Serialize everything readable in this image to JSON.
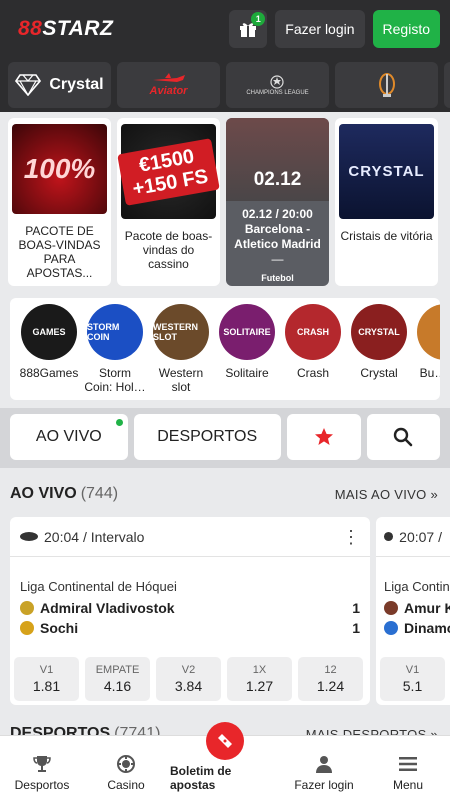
{
  "header": {
    "logo_prefix": "88",
    "logo_text": "STARZ",
    "gift_badge": "1",
    "login_label": "Fazer login",
    "register_label": "Registo"
  },
  "top_categories": [
    {
      "label": "Crystal",
      "icon": "diamond-icon"
    },
    {
      "label": "Aviator",
      "icon": "plane-icon"
    },
    {
      "label": "CHAMPIONS LEAGUE",
      "icon": "ucl-icon"
    },
    {
      "label": "",
      "icon": "trophy-icon"
    }
  ],
  "promos": [
    {
      "img_text": "100%",
      "label": "PACOTE DE BOAS-VINDAS PARA APOSTAS..."
    },
    {
      "img_text": "€1500 +150 FS",
      "label": "Pacote de boas-vindas do cassino"
    },
    {
      "date": "02.12",
      "time": "02.12 / 20:00",
      "teams": "Barcelona - Atletico Madrid",
      "dash": "—",
      "sport": "Futebol"
    },
    {
      "img_text": "CRYSTAL",
      "label": "Cristais de vitória"
    }
  ],
  "games": [
    {
      "icon_text": "GAMES",
      "label": "888Games",
      "color": "#1a1a1a"
    },
    {
      "icon_text": "STORM COIN",
      "label": "Storm Coin: Hol…",
      "color": "#1b4fc4"
    },
    {
      "icon_text": "WESTERN SLOT",
      "label": "Western slot",
      "color": "#6b4a2a"
    },
    {
      "icon_text": "SOLITAIRE",
      "label": "Solitaire",
      "color": "#7a1e6e"
    },
    {
      "icon_text": "CRASH",
      "label": "Crash",
      "color": "#b4282d"
    },
    {
      "icon_text": "CRYSTAL",
      "label": "Crystal",
      "color": "#8a1f1f"
    },
    {
      "icon_text": "",
      "label": "Bu… H…",
      "color": "#c77a2a"
    }
  ],
  "tabs": {
    "live": "AO VIVO",
    "sports": "DESPORTOS"
  },
  "live_section": {
    "title": "AO VIVO",
    "count": "(744)",
    "more": "MAIS AO VIVO"
  },
  "sports_section": {
    "title": "DESPORTOS",
    "count": "(7741)",
    "more": "MAIS DESPORTOS"
  },
  "events": [
    {
      "time": "20:04",
      "status": "/ Intervalo",
      "league": "Liga Continental de Hóquei",
      "team1": "Admiral Vladivostok",
      "team2": "Sochi",
      "score1": "1",
      "score2": "1",
      "odds": [
        {
          "label": "V1",
          "value": "1.81"
        },
        {
          "label": "EMPATE",
          "value": "4.16"
        },
        {
          "label": "V2",
          "value": "3.84"
        },
        {
          "label": "1X",
          "value": "1.27"
        },
        {
          "label": "12",
          "value": "1.24"
        }
      ]
    },
    {
      "time": "20:07",
      "status": "/",
      "league": "Liga Contin…",
      "team1": "Amur K…",
      "team2": "Dinamo…",
      "odds": [
        {
          "label": "V1",
          "value": "5.1"
        }
      ]
    }
  ],
  "bottom_nav": {
    "sports": "Desportos",
    "casino": "Casino",
    "betslip": "Boletim de apostas",
    "login": "Fazer login",
    "menu": "Menu"
  }
}
